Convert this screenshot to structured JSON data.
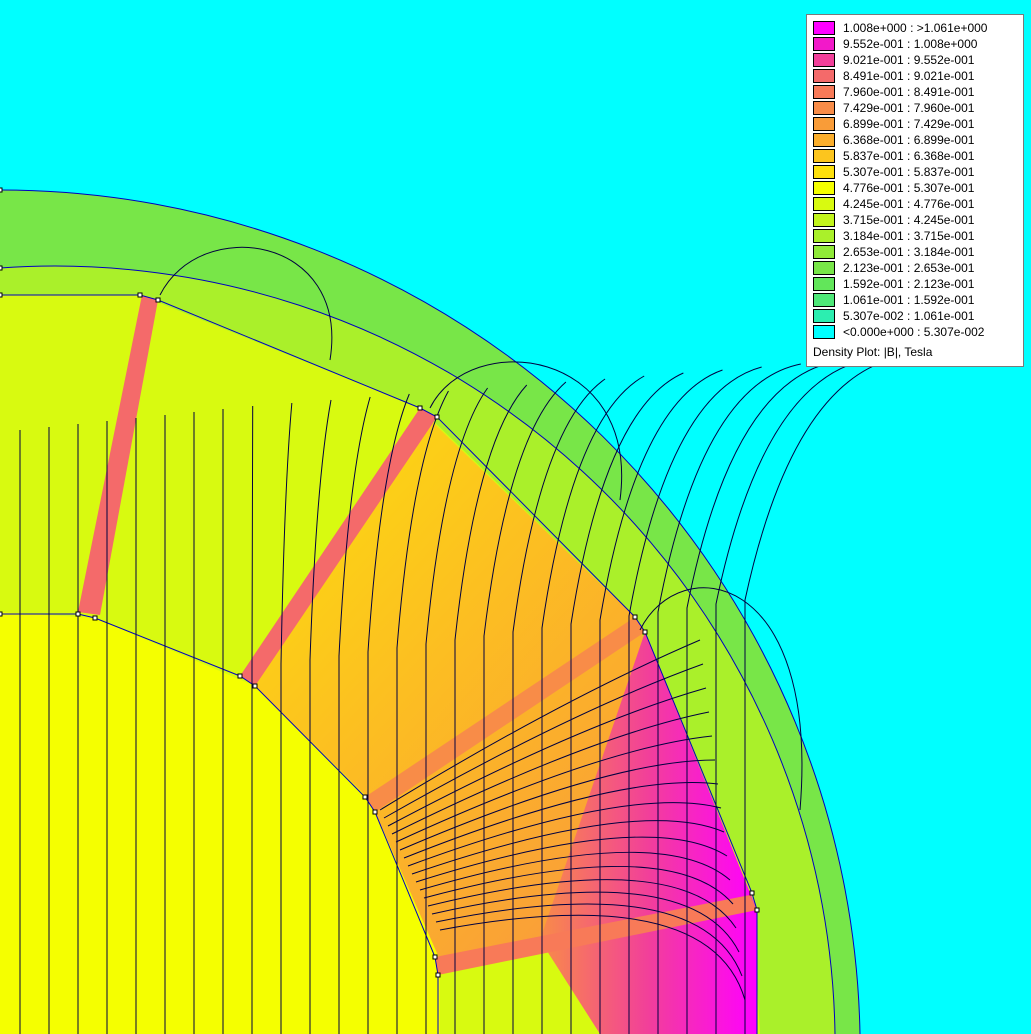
{
  "legend": {
    "title": "Density Plot: |B|, Tesla",
    "entries": [
      {
        "label": "1.008e+000 : >1.061e+000",
        "color": "#ff00ff"
      },
      {
        "label": "9.552e-001 : 1.008e+000",
        "color": "#f219c9"
      },
      {
        "label": "9.021e-001 : 9.552e-001",
        "color": "#f23f9a"
      },
      {
        "label": "8.491e-001 : 9.021e-001",
        "color": "#f46a6a"
      },
      {
        "label": "7.960e-001 : 8.491e-001",
        "color": "#f87a58"
      },
      {
        "label": "7.429e-001 : 7.960e-001",
        "color": "#f88c48"
      },
      {
        "label": "6.899e-001 : 7.429e-001",
        "color": "#f99c38"
      },
      {
        "label": "6.368e-001 : 6.899e-001",
        "color": "#fbae2c"
      },
      {
        "label": "5.837e-001 : 6.368e-001",
        "color": "#fcc51e"
      },
      {
        "label": "5.307e-001 : 5.837e-001",
        "color": "#fde00c"
      },
      {
        "label": "4.776e-001 : 5.307e-001",
        "color": "#f5ff00"
      },
      {
        "label": "4.245e-001 : 4.776e-001",
        "color": "#d8fa10"
      },
      {
        "label": "3.715e-001 : 4.245e-001",
        "color": "#c2f51c"
      },
      {
        "label": "3.184e-001 : 3.715e-001",
        "color": "#aaf02a"
      },
      {
        "label": "2.653e-001 : 3.184e-001",
        "color": "#90ea38"
      },
      {
        "label": "2.123e-001 : 2.653e-001",
        "color": "#78e648"
      },
      {
        "label": "1.592e-001 : 2.123e-001",
        "color": "#62e65a"
      },
      {
        "label": "1.061e-001 : 1.592e-001",
        "color": "#4ee878"
      },
      {
        "label": "5.307e-002 : 1.061e-001",
        "color": "#2ceeb0"
      },
      {
        "label": "<0.000e+000 : 5.307e-002",
        "color": "#00ffff"
      }
    ]
  },
  "colors": {
    "background": "#00ffff",
    "contour_line": "#000040",
    "boundary_line": "#0000c0"
  }
}
